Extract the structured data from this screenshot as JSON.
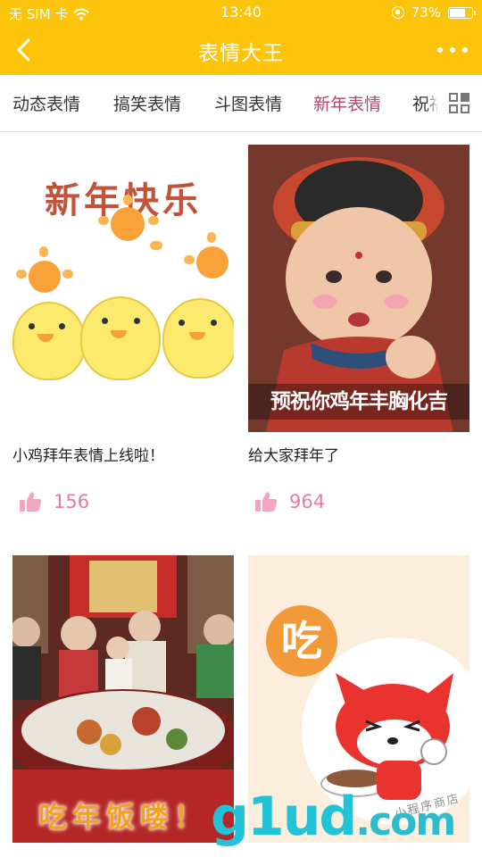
{
  "status_bar": {
    "carrier": "无 SIM 卡",
    "time": "13:40",
    "battery": "73%",
    "battery_level": 0.73
  },
  "nav": {
    "title": "表情大王",
    "back_icon": "chevron-left-icon",
    "more_icon": "more-dots-icon"
  },
  "tabs": [
    {
      "label": "动态表情",
      "active": false
    },
    {
      "label": "搞笑表情",
      "active": false
    },
    {
      "label": "斗图表情",
      "active": false
    },
    {
      "label": "新年表情",
      "active": true
    },
    {
      "label": "祝福表情",
      "active": false
    }
  ],
  "colors": {
    "brand_yellow": "#fcc40a",
    "active_tab": "#b5456a",
    "like_pink": "#e87ba0"
  },
  "cards": [
    {
      "image_text": "新年快乐",
      "caption": "小鸡拜年表情上线啦！",
      "likes": "156"
    },
    {
      "image_text": "预祝你鸡年丰胸化吉",
      "caption": "给大家拜年了",
      "likes": "964"
    },
    {
      "image_text": "吃年饭喽！",
      "caption": "",
      "likes": ""
    },
    {
      "image_text": "吃",
      "image_tag": "小程序商店",
      "caption": "",
      "likes": ""
    }
  ],
  "watermark": {
    "main": "g1ud",
    "suffix": ".com"
  }
}
